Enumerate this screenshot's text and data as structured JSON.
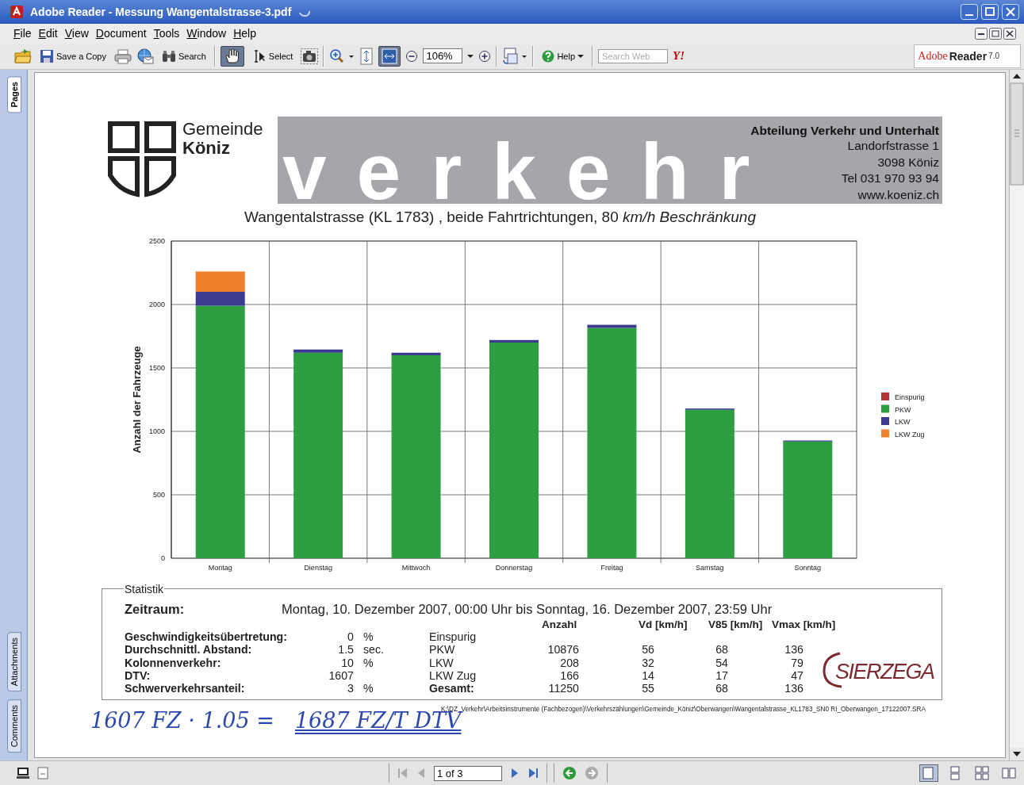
{
  "window": {
    "title": "Adobe Reader - Messung Wangentalstrasse-3.pdf"
  },
  "menu": [
    "File",
    "Edit",
    "View",
    "Document",
    "Tools",
    "Window",
    "Help"
  ],
  "toolbar": {
    "save_copy_label": "Save a Copy",
    "search_label": "Search",
    "hand_tool_selected": true,
    "select_label": "Select",
    "fit_width_selected": true,
    "zoom_value": "106%",
    "help_label": "Help",
    "search_placeholder": "Search Web",
    "yahoo_label": "Y!",
    "brand": {
      "adobe": "Adobe",
      "reader": "Reader",
      "version": "7.0"
    }
  },
  "side_tabs": [
    {
      "label": "Pages",
      "selected": true
    },
    {
      "label": "Attachments",
      "selected": false
    },
    {
      "label": "Comments",
      "selected": false
    }
  ],
  "document": {
    "header": {
      "municipality": "Gemeinde",
      "town": "Köniz",
      "banner_word": "verkehr",
      "department": "Abteilung Verkehr und Unterhalt",
      "address": [
        "Landorfstrasse 1",
        "3098 Köniz",
        "Tel 031 970 93 94",
        "www.koeniz.ch"
      ]
    },
    "subtitle": "Wangentalstrasse (KL 1783) , beide Fahrtrichtungen, 80 *km/h Beschränkung*",
    "chart_data": {
      "type": "bar",
      "stacked": true,
      "ylabel": "Anzahl der Fahrzeuge",
      "categories": [
        "Montag",
        "Dienstag",
        "Mittwoch",
        "Donnerstag",
        "Freitag",
        "Samstag",
        "Sonntag"
      ],
      "ylim": [
        0,
        2500
      ],
      "grid": true,
      "legend": true,
      "yticks": [
        {
          "value": 0,
          "label": "0"
        },
        {
          "value": 500,
          "label": "500"
        },
        {
          "value": 1000,
          "label": "1000"
        },
        {
          "value": 1500,
          "label": "1500"
        },
        {
          "value": 2000,
          "label": "2000"
        },
        {
          "value": 2500,
          "label": "2500"
        }
      ],
      "series": [
        {
          "name": "Einspurig",
          "color": "#b03434",
          "values": [
            0,
            0,
            0,
            0,
            0,
            0,
            0
          ]
        },
        {
          "name": "PKW",
          "color": "#2e9e42",
          "values": [
            1990,
            1620,
            1600,
            1700,
            1815,
            1170,
            920
          ]
        },
        {
          "name": "LKW",
          "color": "#3b3a8e",
          "values": [
            110,
            25,
            20,
            20,
            25,
            10,
            8
          ]
        },
        {
          "name": "LKW Zug",
          "color": "#f0802c",
          "values": [
            160,
            0,
            0,
            0,
            0,
            0,
            0
          ]
        }
      ]
    },
    "statistics": {
      "legend": "Statistik",
      "period_label": "Zeitraum:",
      "period": "Montag, 10. Dezember 2007, 00:00 Uhr bis Sonntag, 16. Dezember 2007, 23:59 Uhr",
      "headers": [
        "Anzahl",
        "Vd [km/h]",
        "V85 [km/h]",
        "Vmax [km/h]"
      ],
      "rows": [
        {
          "kind": "class",
          "label": "Geschwindigkeitsübertretung:",
          "value": "0",
          "unit": "%",
          "type": "Einspurig"
        },
        {
          "kind": "class",
          "label": "Durchschnittl. Abstand:",
          "value": "1.5",
          "unit": "sec.",
          "type": "PKW",
          "count": "10876",
          "vd": "56",
          "v85": "68",
          "vmax": "136"
        },
        {
          "kind": "class",
          "label": "Kolonnenverkehr:",
          "value": "10",
          "unit": "%",
          "type": "LKW",
          "count": "208",
          "vd": "32",
          "v85": "54",
          "vmax": "79"
        },
        {
          "kind": "class",
          "label": "DTV:",
          "value": "1607",
          "type": "LKW Zug",
          "count": "166",
          "vd": "14",
          "v85": "17",
          "vmax": "47"
        },
        {
          "kind": "total",
          "label": "Schwerverkehrsanteil:",
          "value": "3",
          "unit": "%",
          "type": "Gesamt:",
          "count": "11250",
          "vd": "55",
          "v85": "68",
          "vmax": "136"
        }
      ],
      "logo": "SIERZEGA"
    },
    "file_path": "K:\\DZ_Verkehr\\Arbeitsinstrumente (Fachbezogen)\\Verkehrszählungen\\Gemeinde_Köniz\\Oberwangen\\Wangentalstrasse_KL1783_SN0 RI_Oberwangen_17122007.SRA",
    "handwriting": [
      "1607 FZ · 1.05 =",
      "1687 FZ/T  DTV"
    ]
  },
  "status_bar": {
    "page_field": "1 of 3",
    "layouts": [
      {
        "selected": true
      },
      {
        "selected": false
      },
      {
        "selected": false
      },
      {
        "selected": false
      }
    ]
  }
}
